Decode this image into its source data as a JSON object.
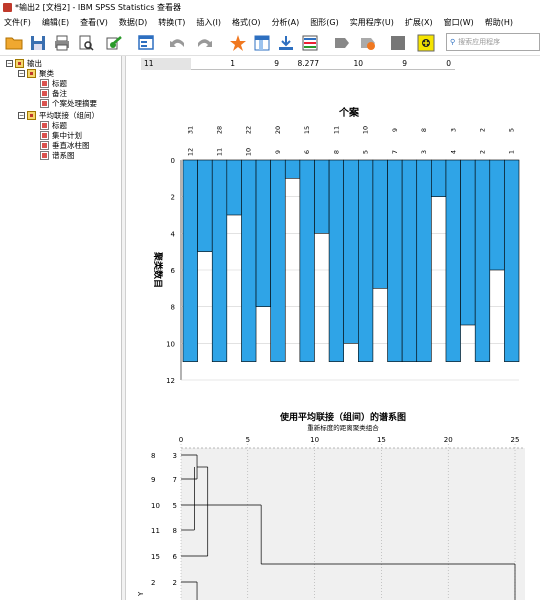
{
  "window": {
    "title": "*输出2 [文档2] - IBM SPSS Statistics 查看器"
  },
  "menu": [
    "文件(F)",
    "编辑(E)",
    "查看(V)",
    "数据(D)",
    "转换(T)",
    "插入(I)",
    "格式(O)",
    "分析(A)",
    "图形(G)",
    "实用程序(U)",
    "扩展(X)",
    "窗口(W)",
    "帮助(H)"
  ],
  "search": {
    "placeholder": "搜索应用程序"
  },
  "toolbar_icons": [
    "open-folder-icon",
    "save-icon",
    "print-icon",
    "print-preview-icon",
    "export-icon",
    "recall-dialog-icon",
    "undo-icon",
    "redo-icon",
    "goto-case-icon",
    "goto-variable-icon",
    "variables-icon",
    "insert-output-icon",
    "promote-icon",
    "demote-icon",
    "show-all-icon",
    "hide-icon",
    "designate-window-icon"
  ],
  "nav_tree": [
    {
      "label": "输出",
      "level": 0,
      "icon": "book"
    },
    {
      "label": "聚类",
      "level": 1,
      "icon": "book"
    },
    {
      "label": "标题",
      "level": 2,
      "icon": "doc"
    },
    {
      "label": "备注",
      "level": 2,
      "icon": "doc"
    },
    {
      "label": "个案处理摘要",
      "level": 2,
      "icon": "doc"
    },
    {
      "label": "平均联接（组间）",
      "level": 1,
      "icon": "book"
    },
    {
      "label": "标题",
      "level": 2,
      "icon": "doc"
    },
    {
      "label": "集中计划",
      "level": 2,
      "icon": "doc"
    },
    {
      "label": "垂直冰柱图",
      "level": 2,
      "icon": "doc"
    },
    {
      "label": "谱系图",
      "level": 2,
      "icon": "doc"
    }
  ],
  "table_row": [
    "11",
    "1",
    "9",
    "8.277",
    "10",
    "9",
    "0"
  ],
  "chart_data": [
    {
      "type": "bar",
      "title": "个案",
      "ylabel": "聚类数目",
      "ylim": [
        0,
        12
      ],
      "yticks": [
        0,
        2,
        4,
        6,
        8,
        10,
        12
      ],
      "orientation": "inverted",
      "top_labels_case": [
        "12",
        "",
        "10",
        "",
        "9",
        "",
        "6",
        "",
        "8",
        "",
        "5",
        "",
        "7",
        "",
        "3",
        "",
        "4",
        "",
        "2",
        "",
        "1"
      ],
      "top_labels_number": [
        "31",
        "",
        "28",
        "",
        "22",
        "",
        "20",
        "",
        "15",
        "",
        "11",
        "",
        "10",
        "",
        "9",
        "",
        "8",
        "",
        "3",
        "",
        "2",
        "",
        "5"
      ],
      "case_labels_row1": [
        "31",
        "28",
        "22",
        "20",
        "15",
        "11",
        "10",
        "9",
        "8",
        "3",
        "2",
        "5"
      ],
      "case_labels_row2": [
        "12",
        "11",
        "10",
        "9",
        "6",
        "8",
        "5",
        "7",
        "3",
        "4",
        "2",
        "1"
      ],
      "case_values": [
        11,
        11,
        11,
        11,
        11,
        11,
        11,
        11,
        11,
        11,
        11,
        11
      ],
      "gap_values": [
        5,
        3,
        8,
        1,
        4,
        10,
        7,
        11,
        2,
        9,
        6
      ],
      "color": "#2fa4e7"
    },
    {
      "type": "dendrogram",
      "title": "使用平均联接（组间）的谱系图",
      "subtitle": "重新标度的距离聚类组合",
      "xlim": [
        0,
        25
      ],
      "xticks": [
        0,
        5,
        10,
        15,
        20,
        25
      ],
      "row_names": [
        "8",
        "9",
        "10",
        "11",
        "15",
        "2"
      ],
      "row_ids": [
        "3",
        "7",
        "5",
        "8",
        "6",
        "2"
      ],
      "ylabel": "Y"
    }
  ]
}
